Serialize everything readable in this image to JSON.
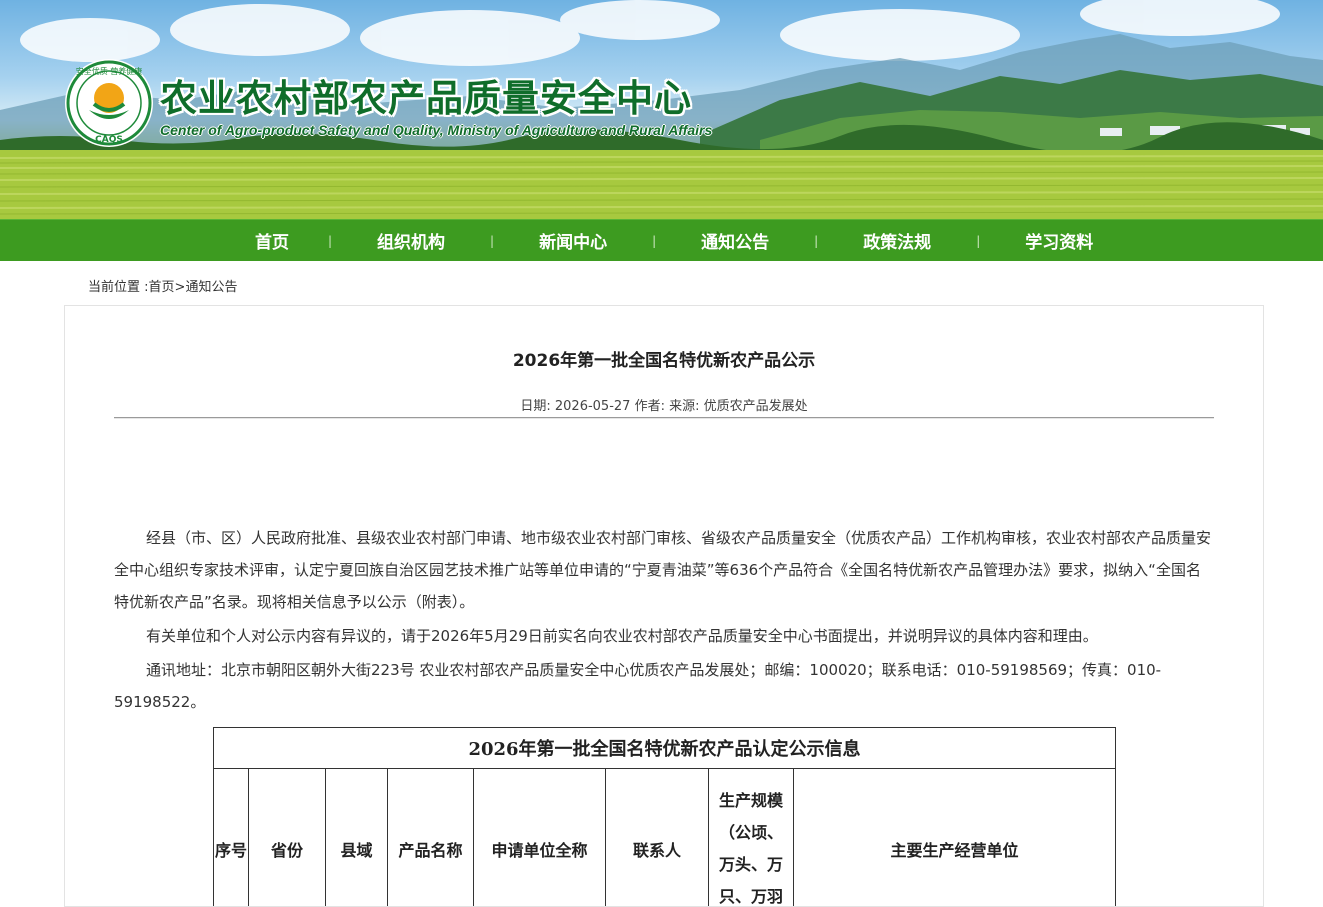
{
  "header": {
    "site_title_cn": "农业农村部农产品质量安全中心",
    "site_title_en": "Center of Agro-product Safety and Quality, Ministry of Agriculture and Rural Affairs",
    "logo_text_top": "安全优质 营养健康",
    "logo_text_bottom": "CAQS"
  },
  "nav": {
    "items": [
      "首页",
      "组织机构",
      "新闻中心",
      "通知公告",
      "政策法规",
      "学习资料"
    ],
    "separator": "|"
  },
  "breadcrumb": {
    "prefix": "当前位置 :",
    "home": "首页",
    "sep": ">",
    "current": "通知公告"
  },
  "article": {
    "title": "2026年第一批全国名特优新农产品公示",
    "date_label": "日期:",
    "date": "2026-05-27",
    "author_label": "作者:",
    "author": "",
    "source_label": "来源:",
    "source": "优质农产品发展处",
    "paragraphs": [
      "经县（市、区）人民政府批准、县级农业农村部门申请、地市级农业农村部门审核、省级农产品质量安全（优质农产品）工作机构审核，农业农村部农产品质量安全中心组织专家技术评审，认定宁夏回族自治区园艺技术推广站等单位申请的“宁夏青油菜”等636个产品符合《全国名特优新农产品管理办法》要求，拟纳入“全国名特优新农产品”名录。现将相关信息予以公示（附表）。",
      "有关单位和个人对公示内容有异议的，请于2026年5月29日前实名向农业农村部农产品质量安全中心书面提出，并说明异议的具体内容和理由。",
      "通讯地址：北京市朝阳区朝外大街223号 农业农村部农产品质量安全中心优质农产品发展处；邮编：100020；联系电话：010-59198569；传真：010-59198522。"
    ]
  },
  "table": {
    "caption": "2026年第一批全国名特优新农产品认定公示信息",
    "headers": [
      "序号",
      "省份",
      "县域",
      "产品名称",
      "申请单位全称",
      "联系人",
      "生产规模（公顷、万头、万只、万羽",
      "主要生产经营单位"
    ]
  }
}
